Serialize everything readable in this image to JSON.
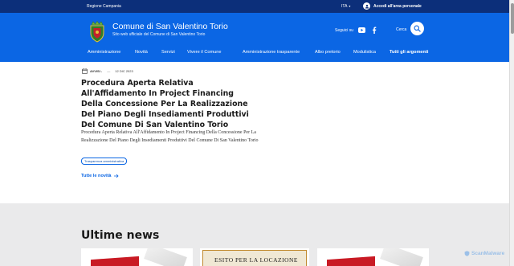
{
  "topbar": {
    "region": "Regione Campania",
    "language": "ITA",
    "login_label": "Accedi all'area personale"
  },
  "header": {
    "title": "Comune di San Valentino Torio",
    "subtitle": "Sito web ufficiale del Comune di San Valentino Torio",
    "social_label": "Seguici su",
    "search_label": "Cerca"
  },
  "nav": {
    "items": [
      "Amministrazione",
      "Novità",
      "Servizi",
      "Vivere il Comune",
      "Amministrazione trasparente",
      "Albo pretorio",
      "Modulistica",
      "Tutti gli argomenti"
    ]
  },
  "article": {
    "category": "AVVISI -",
    "date": "12 DIC 2023",
    "title": "Procedura Aperta Relativa All'Affidamento In Project Financing Della Concessione Per La Realizzazione Del Piano Degli Insediamenti Produttivi Del Comune Di San Valentino Torio",
    "description": "Procedura Aperta Relativa All'Affidamento In Project Financing Della Concessione Per La Realizzazione Del Piano Degli Insediamenti Produttivi Del Comune Di San Valentino Torio",
    "tag": "Trasparenza amministrativa",
    "all_news": "Tutte le novità"
  },
  "news": {
    "heading": "Ultime news",
    "card2_text": "ESITO PER LA LOCAZIONE"
  },
  "watermark": "ScanMalware",
  "colors": {
    "topbar": "#0c2f7a",
    "header": "#0b66e4",
    "link": "#0b66e4",
    "news_bg": "#eaeaeb"
  }
}
